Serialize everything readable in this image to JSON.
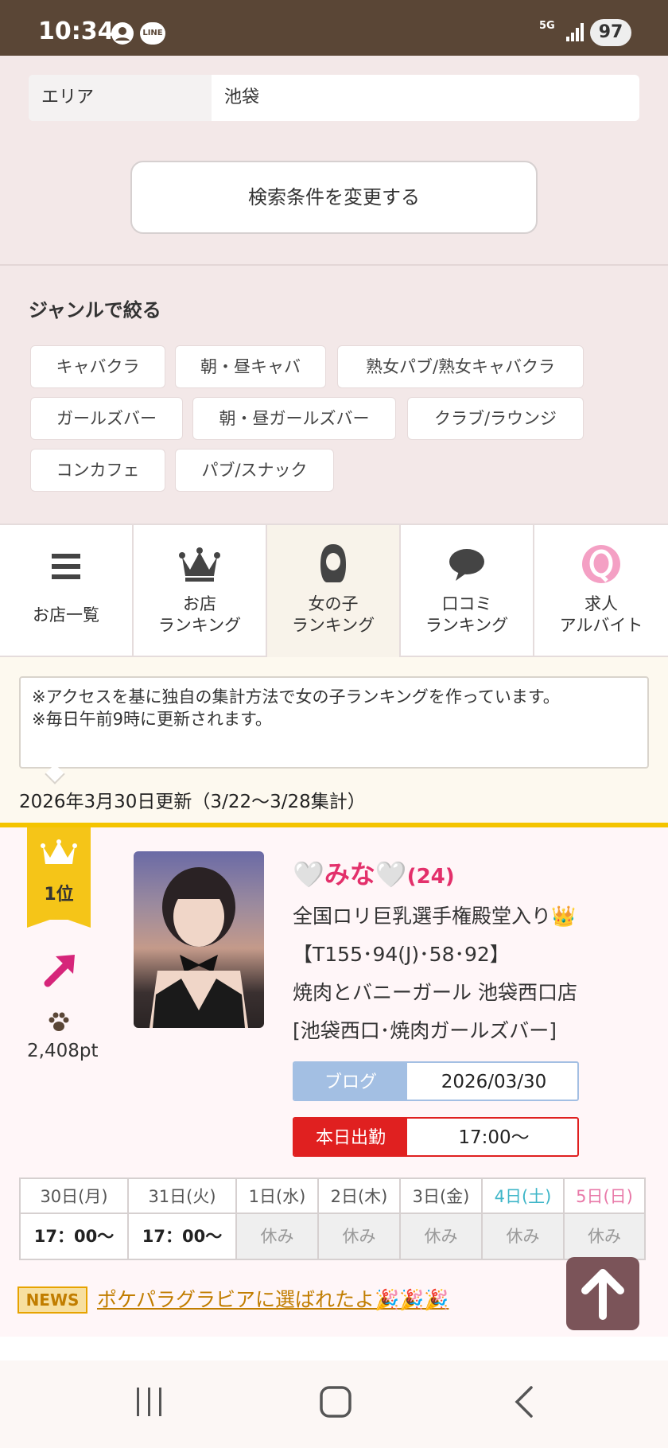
{
  "status_bar": {
    "time": "10:34",
    "network": "5G",
    "battery": "97",
    "line_icon": "LINE"
  },
  "search": {
    "area_label": "エリア",
    "area_value": "池袋",
    "change_button": "検索条件を変更する"
  },
  "genre": {
    "title": "ジャンルで絞る",
    "chips": [
      "キャバクラ",
      "朝・昼キャバ",
      "熟女パブ/熟女キャバクラ",
      "ガールズバー",
      "朝・昼ガールズバー",
      "クラブ/ラウンジ",
      "コンカフェ",
      "パブ/スナック"
    ]
  },
  "tabs": [
    {
      "label": "お店一覧",
      "icon": "menu-icon"
    },
    {
      "label": "お店\nランキング",
      "icon": "crown-icon"
    },
    {
      "label": "女の子\nランキング",
      "icon": "girl-icon",
      "active": true
    },
    {
      "label": "口コミ\nランキング",
      "icon": "speech-bubble-icon"
    },
    {
      "label": "求人\nアルバイト",
      "icon": "q-icon"
    }
  ],
  "notice": {
    "line1": "※アクセスを基に独自の集計方法で女の子ランキングを作っています。",
    "line2": "※毎日午前9時に更新されます。",
    "updated": "2026年3月30日更新（3/22〜3/28集計）"
  },
  "ranking": {
    "rank": "1位",
    "trend_icon": "arrow-up-right-icon",
    "points": "2,408pt",
    "name": "🤍みな🤍",
    "age": "(24)",
    "catch": "全国ロリ巨乳選手権殿堂入り👑",
    "spec": "【T155･94(J)･58･92】",
    "shop": "焼肉とバニーガール 池袋西口店",
    "shop_area": "[池袋西口･焼肉ガールズバー]",
    "blog_label": "ブログ",
    "blog_date": "2026/03/30",
    "today_label": "本日出勤",
    "today_time": "17:00〜",
    "colors": {
      "name": "#e3306b",
      "blog": "#a3bfe3",
      "today": "#e02020",
      "saturday": "#3fb6c8",
      "sunday": "#e879a8"
    }
  },
  "schedule": [
    {
      "day": "30日(月)",
      "time": "17：00〜",
      "working": true,
      "type": "weekday"
    },
    {
      "day": "31日(火)",
      "time": "17：00〜",
      "working": true,
      "type": "weekday"
    },
    {
      "day": "1日(水)",
      "time": "休み",
      "working": false,
      "type": "weekday"
    },
    {
      "day": "2日(木)",
      "time": "休み",
      "working": false,
      "type": "weekday"
    },
    {
      "day": "3日(金)",
      "time": "休み",
      "working": false,
      "type": "weekday"
    },
    {
      "day": "4日(土)",
      "time": "休み",
      "working": false,
      "type": "saturday"
    },
    {
      "day": "5日(日)",
      "time": "休み",
      "working": false,
      "type": "sunday"
    }
  ],
  "news": {
    "badge": "NEWS",
    "text": "ポケパラグラビアに選ばれたよ🎉🎉🎉"
  }
}
